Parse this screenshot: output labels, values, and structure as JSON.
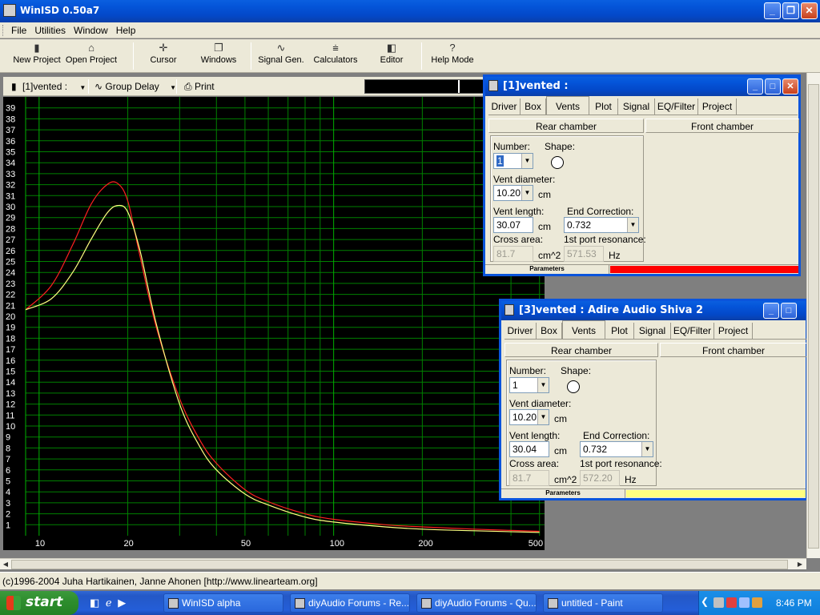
{
  "app": {
    "title": "WinISD 0.50a7"
  },
  "menu": [
    "File",
    "Utilities",
    "Window",
    "Help"
  ],
  "toolbar": [
    {
      "label": "New Project",
      "icon": "new-project-icon"
    },
    {
      "label": "Open Project",
      "icon": "open-project-icon"
    },
    {
      "label": "Cursor",
      "icon": "cursor-icon"
    },
    {
      "label": "Windows",
      "icon": "windows-icon"
    },
    {
      "label": "Signal Gen.",
      "icon": "signal-gen-icon"
    },
    {
      "label": "Calculators",
      "icon": "calculators-icon"
    },
    {
      "label": "Editor",
      "icon": "editor-icon"
    },
    {
      "label": "Help Mode",
      "icon": "help-mode-icon"
    }
  ],
  "graph_toolbar": {
    "project": "[1]vented :",
    "graph": "Group Delay",
    "print": "Print"
  },
  "chart_data": {
    "type": "line",
    "xscale": "log",
    "xlim": [
      9,
      520
    ],
    "ylim": [
      0,
      40
    ],
    "x_ticks": [
      "10",
      "20",
      "50",
      "100",
      "200",
      "500"
    ],
    "y_ticks": [
      "1",
      "2",
      "3",
      "4",
      "5",
      "6",
      "7",
      "8",
      "9",
      "10",
      "11",
      "12",
      "13",
      "14",
      "15",
      "16",
      "17",
      "18",
      "19",
      "20",
      "21",
      "22",
      "23",
      "24",
      "25",
      "26",
      "27",
      "28",
      "29",
      "30",
      "31",
      "32",
      "33",
      "34",
      "35",
      "36",
      "37",
      "38",
      "39"
    ],
    "grid": true,
    "series": [
      {
        "color": "#ff2020",
        "x": [
          9,
          11,
          13,
          15,
          17,
          18.5,
          20,
          22,
          25,
          30,
          35,
          40,
          50,
          60,
          80,
          100,
          150,
          200,
          300,
          500
        ],
        "y": [
          20.6,
          22.8,
          26.5,
          30.2,
          32.0,
          32.1,
          30.5,
          25.5,
          19.0,
          12.5,
          8.8,
          6.6,
          4.2,
          3.1,
          2.0,
          1.5,
          1.0,
          0.8,
          0.6,
          0.4
        ]
      },
      {
        "color": "#ffff80",
        "x": [
          9,
          11,
          13,
          15,
          17,
          18.5,
          20,
          22,
          25,
          30,
          35,
          40,
          50,
          60,
          80,
          100,
          150,
          200,
          300,
          500
        ],
        "y": [
          20.6,
          21.6,
          24.0,
          27.0,
          29.4,
          30.1,
          29.5,
          26.0,
          19.3,
          12.0,
          8.2,
          6.0,
          3.8,
          2.8,
          1.7,
          1.25,
          0.8,
          0.6,
          0.45,
          0.3
        ]
      }
    ]
  },
  "window1": {
    "title": "[1]vented :",
    "tabs": [
      "Driver",
      "Box",
      "Vents",
      "Plot",
      "Signal",
      "EQ/Filter",
      "Project"
    ],
    "active_tab": "Vents",
    "rear": "Rear chamber",
    "front": "Front chamber",
    "number_label": "Number:",
    "number": "1",
    "shape_label": "Shape:",
    "diam_label": "Vent diameter:",
    "diam": "10.20",
    "diam_unit": "cm",
    "length_label": "Vent length:",
    "length": "30.07",
    "length_unit": "cm",
    "endcorr_label": "End Correction:",
    "endcorr": "0.732",
    "cross_label": "Cross area:",
    "cross": "81.7",
    "cross_unit": "cm^2",
    "res_label": "1st port resonance:",
    "res": "571.53",
    "res_unit": "Hz",
    "status": "Parameters",
    "status_color": "#ff0000"
  },
  "window3": {
    "title": "[3]vented : Adire Audio Shiva 2",
    "tabs": [
      "Driver",
      "Box",
      "Vents",
      "Plot",
      "Signal",
      "EQ/Filter",
      "Project"
    ],
    "active_tab": "Vents",
    "rear": "Rear chamber",
    "front": "Front chamber",
    "number_label": "Number:",
    "number": "1",
    "shape_label": "Shape:",
    "diam_label": "Vent diameter:",
    "diam": "10.20",
    "diam_unit": "cm",
    "length_label": "Vent length:",
    "length": "30.04",
    "length_unit": "cm",
    "endcorr_label": "End Correction:",
    "endcorr": "0.732",
    "cross_label": "Cross area:",
    "cross": "81.7",
    "cross_unit": "cm^2",
    "res_label": "1st port resonance:",
    "res": "572.20",
    "res_unit": "Hz",
    "status": "Parameters",
    "status_color": "#ffff80"
  },
  "status_bar": "(c)1996-2004 Juha Hartikainen, Janne Ahonen [http://www.linearteam.org]",
  "taskbar": {
    "start": "start",
    "tasks": [
      "WinISD alpha",
      "diyAudio Forums - Re...",
      "diyAudio Forums - Qu...",
      "untitled - Paint"
    ],
    "time": "8:46 PM"
  }
}
